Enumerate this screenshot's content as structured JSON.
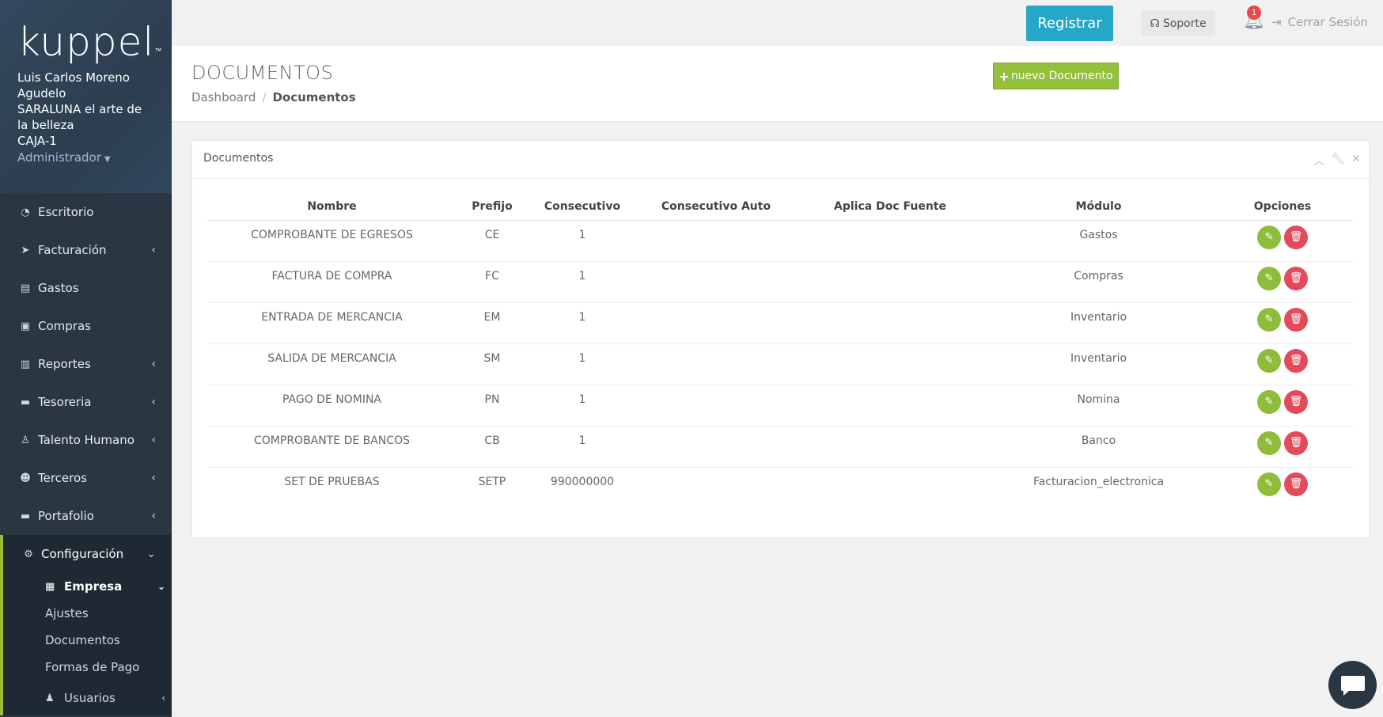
{
  "sidebar": {
    "logo": "kuppel",
    "user_name_1": "Luis Carlos Moreno",
    "user_name_2": "Agudelo",
    "company_1": "SARALUNA el arte de",
    "company_2": "la belleza",
    "register": "CAJA-1",
    "role": "Administrador",
    "items": [
      {
        "label": "Escritorio",
        "icon": "chart-pie-icon"
      },
      {
        "label": "Facturación",
        "icon": "paper-plane-icon"
      },
      {
        "label": "Gastos",
        "icon": "file-icon"
      },
      {
        "label": "Compras",
        "icon": "box-icon"
      },
      {
        "label": "Reportes",
        "icon": "bar-chart-icon"
      },
      {
        "label": "Tesoreria",
        "icon": "briefcase-icon"
      },
      {
        "label": "Talento Humano",
        "icon": "person-icon"
      },
      {
        "label": "Terceros",
        "icon": "users-icon"
      },
      {
        "label": "Portafolio",
        "icon": "briefcase-icon"
      },
      {
        "label": "Configuración",
        "icon": "gear-icon"
      }
    ],
    "sub": {
      "empresa": "Empresa",
      "ajustes": "Ajustes",
      "documentos": "Documentos",
      "formas_pago": "Formas de Pago",
      "usuarios": "Usuarios"
    }
  },
  "topbar": {
    "registrar": "Registrar",
    "soporte": "Soporte",
    "notifications": "1",
    "logout": "Cerrar Sesión"
  },
  "page": {
    "title": "DOCUMENTOS",
    "breadcrumb_home": "Dashboard",
    "breadcrumb_current": "Documentos",
    "new_button": "nuevo Documento"
  },
  "portlet": {
    "caption": "Documentos",
    "columns": [
      "Nombre",
      "Prefijo",
      "Consecutivo",
      "Consecutivo Auto",
      "Aplica Doc Fuente",
      "Módulo",
      "Opciones"
    ],
    "rows": [
      {
        "nombre": "COMPROBANTE DE EGRESOS",
        "prefijo": "CE",
        "consecutivo": "1",
        "auto": "",
        "fuente": "",
        "modulo": "Gastos"
      },
      {
        "nombre": "FACTURA DE COMPRA",
        "prefijo": "FC",
        "consecutivo": "1",
        "auto": "",
        "fuente": "",
        "modulo": "Compras"
      },
      {
        "nombre": "ENTRADA DE MERCANCIA",
        "prefijo": "EM",
        "consecutivo": "1",
        "auto": "",
        "fuente": "",
        "modulo": "Inventario"
      },
      {
        "nombre": "SALIDA DE MERCANCIA",
        "prefijo": "SM",
        "consecutivo": "1",
        "auto": "",
        "fuente": "",
        "modulo": "Inventario"
      },
      {
        "nombre": "PAGO DE NOMINA",
        "prefijo": "PN",
        "consecutivo": "1",
        "auto": "",
        "fuente": "",
        "modulo": "Nomina"
      },
      {
        "nombre": "COMPROBANTE DE BANCOS",
        "prefijo": "CB",
        "consecutivo": "1",
        "auto": "",
        "fuente": "",
        "modulo": "Banco"
      },
      {
        "nombre": "SET DE PRUEBAS",
        "prefijo": "SETP",
        "consecutivo": "990000000",
        "auto": "",
        "fuente": "",
        "modulo": "Facturacion_electronica"
      }
    ]
  },
  "colors": {
    "sidebar_bg": "#2b3643",
    "accent_green": "#94c03c",
    "registrar_blue": "#26a7c7",
    "delete_red": "#e34a5b"
  }
}
